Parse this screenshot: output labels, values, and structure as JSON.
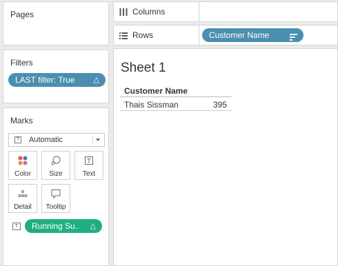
{
  "pages": {
    "title": "Pages"
  },
  "filters": {
    "title": "Filters",
    "pill_label": "LAST filter: True"
  },
  "marks": {
    "title": "Marks",
    "mark_type": "Automatic",
    "buttons": {
      "color": "Color",
      "size": "Size",
      "text": "Text",
      "detail": "Detail",
      "tooltip": "Tooltip"
    },
    "pill_label": "Running Su.."
  },
  "shelves": {
    "columns_label": "Columns",
    "rows_label": "Rows",
    "rows_pill": "Customer Name"
  },
  "sheet": {
    "title": "Sheet 1",
    "column_header": "Customer Name",
    "rows": [
      {
        "name": "Thais Sissman",
        "value": "395"
      }
    ]
  },
  "colors": {
    "dimension_pill": "#4b8fb0",
    "measure_pill": "#1fae83"
  }
}
